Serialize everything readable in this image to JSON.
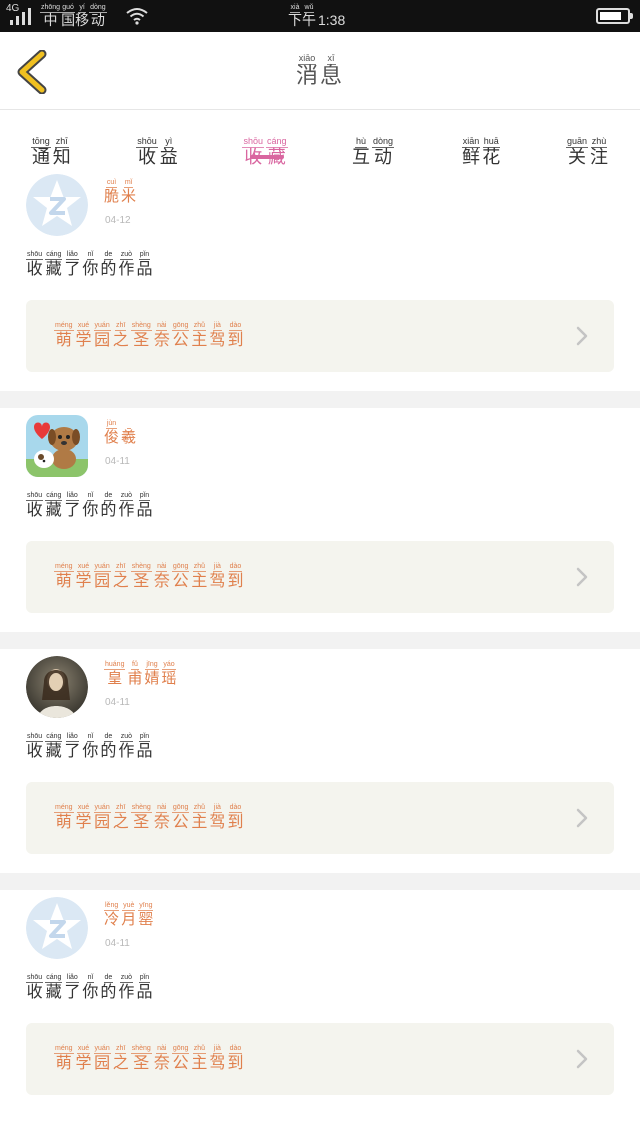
{
  "status_bar": {
    "network": "4G",
    "carrier": [
      {
        "py": "zhōng",
        "hz": "中"
      },
      {
        "py": "guó",
        "hz": "国"
      },
      {
        "py": "yí",
        "hz": "移"
      },
      {
        "py": "dòng",
        "hz": "动"
      }
    ],
    "time_prefix": [
      {
        "py": "xià",
        "hz": "下"
      },
      {
        "py": "wǔ",
        "hz": "午"
      }
    ],
    "time_digits": "1:38",
    "battery_level": 0.8,
    "icons": {
      "signal": "signal-icon",
      "wifi": "wifi-icon",
      "battery": "battery-icon"
    }
  },
  "header": {
    "title": [
      {
        "py": "xiāo",
        "hz": "消"
      },
      {
        "py": "xī",
        "hz": "息"
      }
    ],
    "back_icon": "chevron-left-icon",
    "accent_color": "#f0c020"
  },
  "tabs": [
    {
      "name": "notice",
      "active": false,
      "chars": [
        {
          "py": "tōng",
          "hz": "通"
        },
        {
          "py": "zhī",
          "hz": "知"
        }
      ]
    },
    {
      "name": "earnings",
      "active": false,
      "chars": [
        {
          "py": "shōu",
          "hz": "收"
        },
        {
          "py": "yì",
          "hz": "益"
        }
      ]
    },
    {
      "name": "favorites",
      "active": true,
      "chars": [
        {
          "py": "shōu",
          "hz": "收"
        },
        {
          "py": "cáng",
          "hz": "藏"
        }
      ]
    },
    {
      "name": "interaction",
      "active": false,
      "chars": [
        {
          "py": "hù",
          "hz": "互"
        },
        {
          "py": "dòng",
          "hz": "动"
        }
      ]
    },
    {
      "name": "flowers",
      "active": false,
      "chars": [
        {
          "py": "xiān",
          "hz": "鲜"
        },
        {
          "py": "huā",
          "hz": "花"
        }
      ]
    },
    {
      "name": "following",
      "active": false,
      "chars": [
        {
          "py": "guān",
          "hz": "关"
        },
        {
          "py": "zhù",
          "hz": "注"
        }
      ]
    }
  ],
  "colors": {
    "tab_active": "#d966a0",
    "nickname": "#e0804d",
    "work_box_bg": "#f4f4ee",
    "separator": "#f2f2f2"
  },
  "messages": [
    {
      "avatar": "qq-default-avatar",
      "nickname": [
        {
          "py": "cuì",
          "hz": "脆"
        },
        {
          "py": "mǐ",
          "hz": "米"
        }
      ],
      "date": "04-12",
      "action": [
        {
          "py": "shōu",
          "hz": "收"
        },
        {
          "py": "cáng",
          "hz": "藏"
        },
        {
          "py": "liǎo",
          "hz": "了"
        },
        {
          "py": "nǐ",
          "hz": "你"
        },
        {
          "py": "de",
          "hz": "的"
        },
        {
          "py": "zuò",
          "hz": "作"
        },
        {
          "py": "pǐn",
          "hz": "品"
        }
      ],
      "work": [
        {
          "py": "méng",
          "hz": "萌"
        },
        {
          "py": "xué",
          "hz": "学"
        },
        {
          "py": "yuán",
          "hz": "园"
        },
        {
          "py": "zhī",
          "hz": "之"
        },
        {
          "py": "shèng",
          "hz": "圣"
        },
        {
          "py": "nài",
          "hz": "奈"
        },
        {
          "py": "gōng",
          "hz": "公"
        },
        {
          "py": "zhǔ",
          "hz": "主"
        },
        {
          "py": "jià",
          "hz": "驾"
        },
        {
          "py": "dào",
          "hz": "到"
        }
      ]
    },
    {
      "avatar": "puppy-cartoon-avatar",
      "nickname": [
        {
          "py": "jùn",
          "hz": "俊"
        },
        {
          "py": "",
          "hz": "羲"
        }
      ],
      "date": "04-11",
      "action": [
        {
          "py": "shōu",
          "hz": "收"
        },
        {
          "py": "cáng",
          "hz": "藏"
        },
        {
          "py": "liǎo",
          "hz": "了"
        },
        {
          "py": "nǐ",
          "hz": "你"
        },
        {
          "py": "de",
          "hz": "的"
        },
        {
          "py": "zuò",
          "hz": "作"
        },
        {
          "py": "pǐn",
          "hz": "品"
        }
      ],
      "work": [
        {
          "py": "méng",
          "hz": "萌"
        },
        {
          "py": "xué",
          "hz": "学"
        },
        {
          "py": "yuán",
          "hz": "园"
        },
        {
          "py": "zhī",
          "hz": "之"
        },
        {
          "py": "shèng",
          "hz": "圣"
        },
        {
          "py": "nài",
          "hz": "奈"
        },
        {
          "py": "gōng",
          "hz": "公"
        },
        {
          "py": "zhǔ",
          "hz": "主"
        },
        {
          "py": "jià",
          "hz": "驾"
        },
        {
          "py": "dào",
          "hz": "到"
        }
      ]
    },
    {
      "avatar": "photo-avatar",
      "nickname": [
        {
          "py": "huáng",
          "hz": "皇"
        },
        {
          "py": "fǔ",
          "hz": "甫"
        },
        {
          "py": "jīng",
          "hz": "婧"
        },
        {
          "py": "yáo",
          "hz": "瑶"
        }
      ],
      "date": "04-11",
      "action": [
        {
          "py": "shōu",
          "hz": "收"
        },
        {
          "py": "cáng",
          "hz": "藏"
        },
        {
          "py": "liǎo",
          "hz": "了"
        },
        {
          "py": "nǐ",
          "hz": "你"
        },
        {
          "py": "de",
          "hz": "的"
        },
        {
          "py": "zuò",
          "hz": "作"
        },
        {
          "py": "pǐn",
          "hz": "品"
        }
      ],
      "work": [
        {
          "py": "méng",
          "hz": "萌"
        },
        {
          "py": "xué",
          "hz": "学"
        },
        {
          "py": "yuán",
          "hz": "园"
        },
        {
          "py": "zhī",
          "hz": "之"
        },
        {
          "py": "shèng",
          "hz": "圣"
        },
        {
          "py": "nài",
          "hz": "奈"
        },
        {
          "py": "gōng",
          "hz": "公"
        },
        {
          "py": "zhǔ",
          "hz": "主"
        },
        {
          "py": "jià",
          "hz": "驾"
        },
        {
          "py": "dào",
          "hz": "到"
        }
      ]
    },
    {
      "avatar": "qq-default-avatar",
      "nickname": [
        {
          "py": "lěng",
          "hz": "冷"
        },
        {
          "py": "yuè",
          "hz": "月"
        },
        {
          "py": "yīng",
          "hz": "罂"
        }
      ],
      "date": "04-11",
      "action": [
        {
          "py": "shōu",
          "hz": "收"
        },
        {
          "py": "cáng",
          "hz": "藏"
        },
        {
          "py": "liǎo",
          "hz": "了"
        },
        {
          "py": "nǐ",
          "hz": "你"
        },
        {
          "py": "de",
          "hz": "的"
        },
        {
          "py": "zuò",
          "hz": "作"
        },
        {
          "py": "pǐn",
          "hz": "品"
        }
      ],
      "work": [
        {
          "py": "méng",
          "hz": "萌"
        },
        {
          "py": "xué",
          "hz": "学"
        },
        {
          "py": "yuán",
          "hz": "园"
        },
        {
          "py": "zhī",
          "hz": "之"
        },
        {
          "py": "shèng",
          "hz": "圣"
        },
        {
          "py": "nài",
          "hz": "奈"
        },
        {
          "py": "gōng",
          "hz": "公"
        },
        {
          "py": "zhǔ",
          "hz": "主"
        },
        {
          "py": "jià",
          "hz": "驾"
        },
        {
          "py": "dào",
          "hz": "到"
        }
      ]
    }
  ]
}
